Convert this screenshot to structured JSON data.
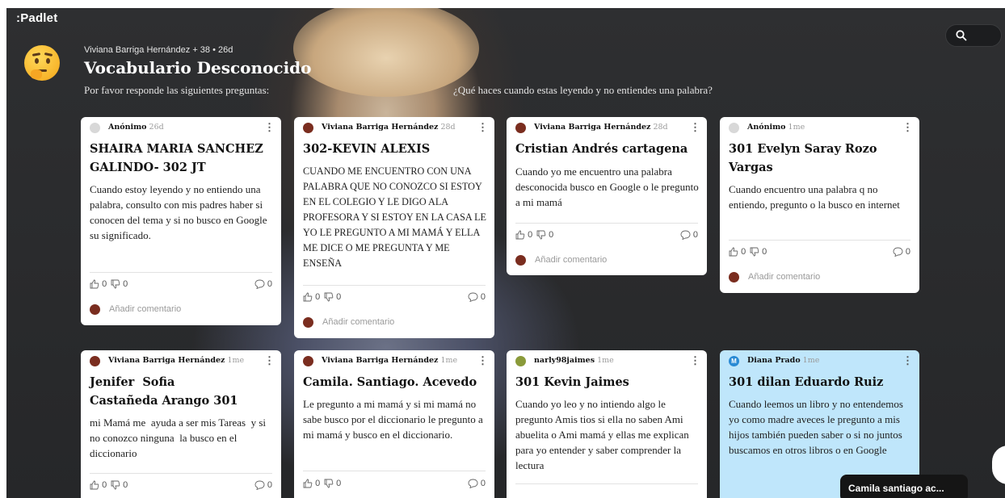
{
  "app": {
    "logo": ":Padlet"
  },
  "board": {
    "meta": "Viviana Barriga Hernández + 38 • 26d",
    "title": "Vocabulario Desconocido",
    "description": "Por favor responde las siguientes preguntas:",
    "question": "¿Qué haces cuando estas leyendo y no entiendes una palabra?"
  },
  "toast": "Camila santiago ac...",
  "colors": {
    "card_blue": "#bfe6fb",
    "background": "#2a2b2d",
    "comment_avatar": "#7a2d1f"
  },
  "icons": [
    "search-icon",
    "thumbs-up-icon",
    "thumbs-down-icon",
    "comment-bubble-icon",
    "kebab-menu-icon"
  ],
  "cards": [
    {
      "author": "Anónimo",
      "age": "26d",
      "title": "SHAIRA MARIA SANCHEZ GALINDO- 302 JT",
      "body": "Cuando estoy leyendo y no entiendo una palabra, consulto con mis padres haber si conocen del tema y si no busco en Google su significado.",
      "likes": "0",
      "dislikes": "0",
      "comments": "0",
      "add_comment": "Añadir comentario"
    },
    {
      "author": "Viviana Barriga Hernández",
      "age": "28d",
      "title": "302-KEVIN ALEXIS",
      "body": "CUANDO ME ENCUENTRO CON UNA PALABRA QUE NO CONOZCO SI ESTOY EN EL COLEGIO Y LE DIGO ALA PROFESORA Y SI ESTOY EN LA CASA LE YO LE PREGUNTO A MI MAMÁ Y ELLA ME DICE O ME PREGUNTA Y ME ENSEÑA",
      "likes": "0",
      "dislikes": "0",
      "comments": "0",
      "add_comment": "Añadir comentario"
    },
    {
      "author": "Viviana Barriga Hernández",
      "age": "28d",
      "title": "Cristian Andrés cartagena",
      "body": "Cuando yo me encuentro una palabra desconocida busco en Google o le pregunto a mi mamá",
      "likes": "0",
      "dislikes": "0",
      "comments": "0",
      "add_comment": "Añadir comentario"
    },
    {
      "author": "Anónimo",
      "age": "1me",
      "title": "301 Evelyn Saray Rozo Vargas",
      "body": "Cuando encuentro una palabra q no entiendo, pregunto o la busco en internet",
      "likes": "0",
      "dislikes": "0",
      "comments": "0",
      "add_comment": "Añadir comentario"
    },
    {
      "author": "Viviana Barriga Hernández",
      "age": "1me",
      "title": "Jenifer  Sofia  Castañeda Arango 301",
      "body": "mi Mamá me  ayuda a ser mis Tareas  y si no conozco ninguna  la busco en el diccionario",
      "likes": "0",
      "dislikes": "0",
      "comments": "0"
    },
    {
      "author": "Viviana Barriga Hernández",
      "age": "1me",
      "title": "Camila. Santiago. Acevedo",
      "body": "Le pregunto a mi mamá y si mi mamá no sabe busco por el diccionario le pregunto a mi mamá y busco en el diccionario.",
      "likes": "0",
      "dislikes": "0",
      "comments": "0"
    },
    {
      "author": "narly98jaimes",
      "age": "1me",
      "title": "301 Kevin Jaimes",
      "body": "Cuando yo leo y no intiendo algo le pregunto Amis tios si ella no saben Ami abuelita o Ami mamá y ellas me explican para yo entender y saber comprender la lectura"
    },
    {
      "author": "Diana Prado",
      "age": "1me",
      "avatar_letter": "M",
      "title": "301 dilan Eduardo Ruiz",
      "body": "Cuando leemos un libro y no entendemos yo como madre aveces le pregunto a mis hijos también pueden saber o si no juntos buscamos en otros libros o en Google"
    }
  ]
}
